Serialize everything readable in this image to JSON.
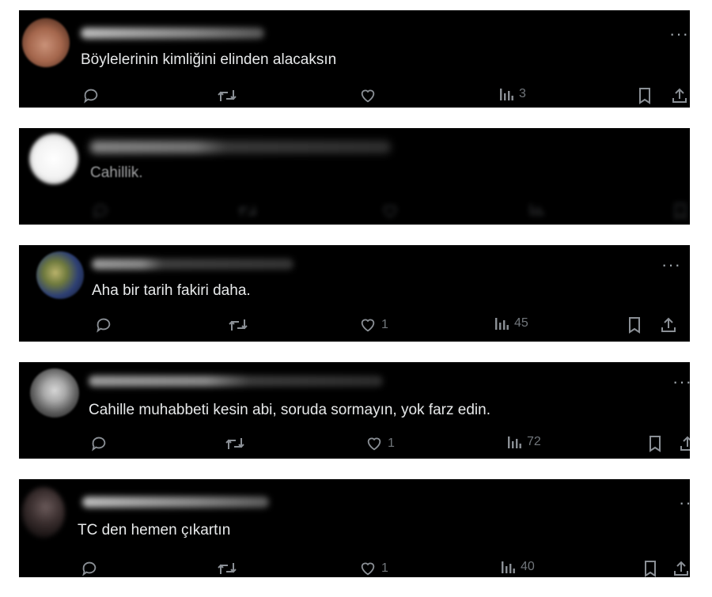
{
  "tweets": [
    {
      "text": "Böylelerinin kimliğini elinden alacaksın",
      "more": "···",
      "reply_count": "",
      "retweet_count": "",
      "like_count": "",
      "views": "3"
    },
    {
      "text": "Cahillik.",
      "more": "",
      "reply_count": "",
      "retweet_count": "",
      "like_count": "",
      "views": ""
    },
    {
      "text": "Aha bir tarih fakiri daha.",
      "more": "···",
      "reply_count": "",
      "retweet_count": "",
      "like_count": "1",
      "views": "45"
    },
    {
      "text": "Cahille muhabbeti kesin abi, soruda sormayın, yok farz edin.",
      "more": "···",
      "reply_count": "",
      "retweet_count": "",
      "like_count": "1",
      "views": "72"
    },
    {
      "text": "TC den hemen çıkartın",
      "more": "··",
      "reply_count": "",
      "retweet_count": "",
      "like_count": "1",
      "views": "40"
    }
  ],
  "colors": {
    "background": "#000000",
    "text": "#e7e9ea",
    "icon": "#71767b"
  }
}
